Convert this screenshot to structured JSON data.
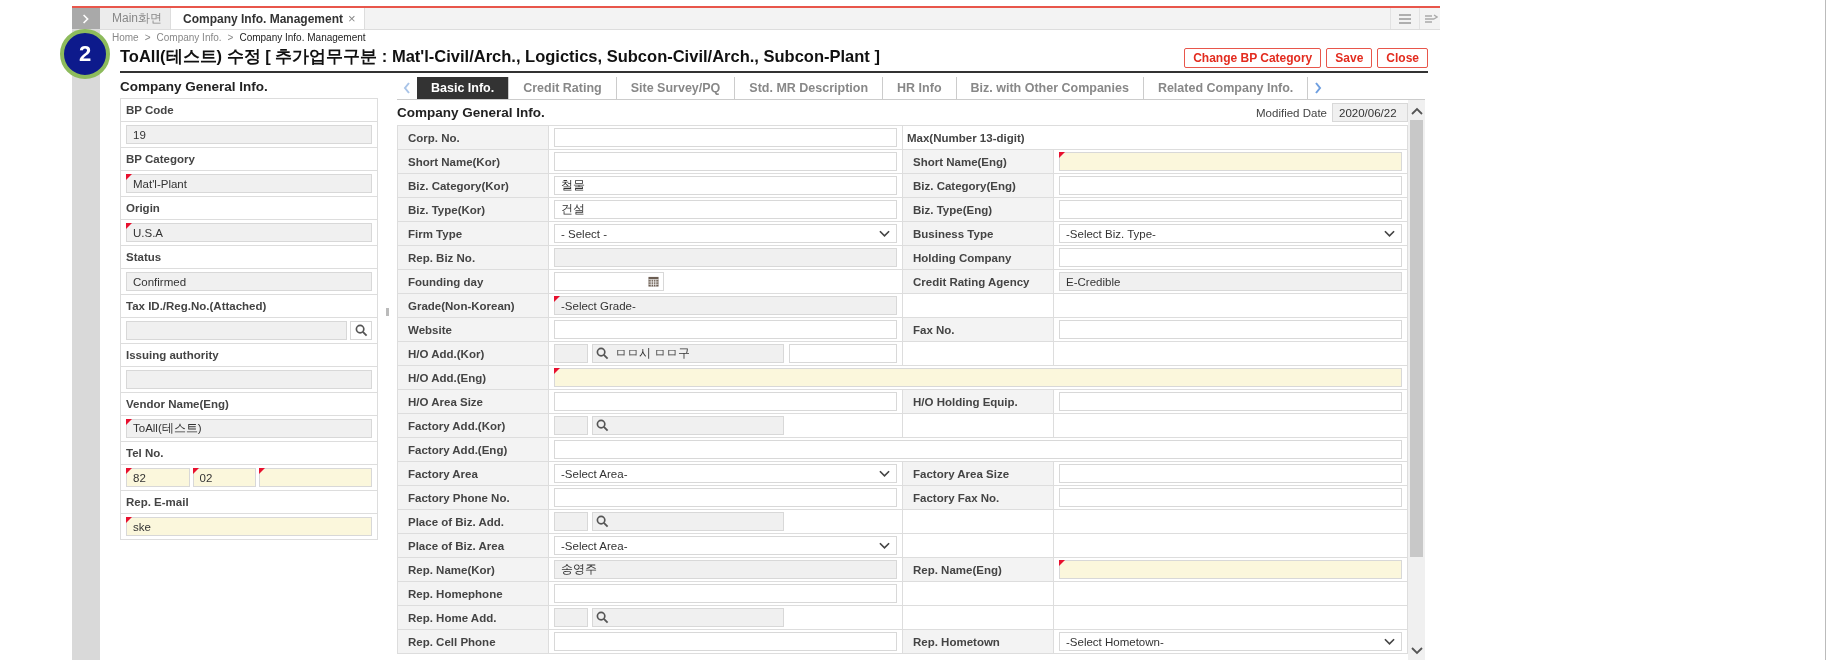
{
  "window_tabs": [
    {
      "label": "Main화면",
      "selected": false
    },
    {
      "label": "Company Info. Management",
      "selected": true,
      "close": "×"
    }
  ],
  "breadcrumb": {
    "separator": ">",
    "items": [
      "Home",
      "Company Info.",
      "Company Info. Management"
    ]
  },
  "step_badge": "2",
  "title": "ToAll(테스트) 수정 [ 추가업무구분 : Mat'l-Civil/Arch., Logictics, Subcon-Civil/Arch., Subcon-Plant ]",
  "buttons": [
    "Change BP Category",
    "Save",
    "Close"
  ],
  "left_panel": {
    "heading": "Company General Info.",
    "fields": [
      {
        "label": "BP Code",
        "parts": [
          {
            "value": "19",
            "kind": "readonly",
            "required": false
          }
        ],
        "search": false
      },
      {
        "label": "BP Category",
        "parts": [
          {
            "value": "Mat'l-Plant",
            "kind": "readonly",
            "required": true
          }
        ],
        "search": false
      },
      {
        "label": "Origin",
        "parts": [
          {
            "value": "U.S.A",
            "kind": "readonly",
            "required": true
          }
        ],
        "search": false
      },
      {
        "label": "Status",
        "parts": [
          {
            "value": "Confirmed",
            "kind": "readonly",
            "required": false
          }
        ],
        "search": false
      },
      {
        "label": "Tax ID./Reg.No.(Attached)",
        "parts": [
          {
            "kind": "readonly",
            "required": false
          }
        ],
        "search": true
      },
      {
        "label": "Issuing authority",
        "parts": [
          {
            "kind": "readonly",
            "required": false
          }
        ],
        "search": false
      },
      {
        "label": "Vendor Name(Eng)",
        "parts": [
          {
            "value": "ToAll(테스트)",
            "kind": "readonly",
            "required": true
          }
        ],
        "search": false
      },
      {
        "label": "Tel No.",
        "parts": [
          {
            "value": "82",
            "kind": "input",
            "required": true
          },
          {
            "value": "02",
            "kind": "input",
            "required": true
          },
          {
            "kind": "input",
            "required": true
          }
        ],
        "search": false
      },
      {
        "label": "Rep. E-mail",
        "parts": [
          {
            "value": "ske",
            "kind": "input",
            "required": true
          }
        ],
        "search": false
      }
    ]
  },
  "form_tabs": [
    {
      "label": "Basic Info.",
      "selected": true
    },
    {
      "label": "Credit Rating",
      "selected": false
    },
    {
      "label": "Site Survey/PQ",
      "selected": false
    },
    {
      "label": "Std. MR Description",
      "selected": false
    },
    {
      "label": "HR Info",
      "selected": false
    },
    {
      "label": "Biz. with Other Companies",
      "selected": false
    },
    {
      "label": "Related Company Info.",
      "selected": false
    }
  ],
  "form": {
    "heading": "Company General Info.",
    "modified_label": "Modified Date",
    "modified_value": "2020/06/22",
    "rows": [
      {
        "cells": [
          {
            "kind": "label",
            "text": "Corp. No."
          },
          {
            "kind": "input",
            "required": false
          },
          {
            "kind": "note",
            "text": "Max(Number 13-digit)"
          }
        ]
      },
      {
        "cells": [
          {
            "kind": "label",
            "text": "Short Name(Kor)"
          },
          {
            "kind": "input",
            "required": false
          },
          {
            "kind": "label",
            "text": "Short Name(Eng)"
          },
          {
            "kind": "input",
            "required": true
          }
        ]
      },
      {
        "cells": [
          {
            "kind": "label",
            "text": "Biz. Category(Kor)"
          },
          {
            "kind": "input",
            "value": "철물",
            "required": false
          },
          {
            "kind": "label",
            "text": "Biz. Category(Eng)"
          },
          {
            "kind": "input",
            "required": false
          }
        ]
      },
      {
        "cells": [
          {
            "kind": "label",
            "text": "Biz. Type(Kor)"
          },
          {
            "kind": "input",
            "value": "건설",
            "required": false
          },
          {
            "kind": "label",
            "text": "Biz. Type(Eng)"
          },
          {
            "kind": "input",
            "required": false
          }
        ]
      },
      {
        "cells": [
          {
            "kind": "label",
            "text": "Firm Type"
          },
          {
            "kind": "select",
            "value": "- Select -"
          },
          {
            "kind": "label",
            "text": "Business Type"
          },
          {
            "kind": "select",
            "value": "-Select Biz. Type-"
          }
        ]
      },
      {
        "cells": [
          {
            "kind": "label",
            "text": "Rep. Biz No."
          },
          {
            "kind": "readonly",
            "required": false
          },
          {
            "kind": "label",
            "text": "Holding Company"
          },
          {
            "kind": "input",
            "required": false
          }
        ]
      },
      {
        "cells": [
          {
            "kind": "label",
            "text": "Founding day"
          },
          {
            "kind": "date"
          },
          {
            "kind": "label",
            "text": "Credit Rating Agency"
          },
          {
            "kind": "readonly",
            "value": "E-Credible",
            "required": false
          }
        ]
      },
      {
        "cells": [
          {
            "kind": "label",
            "text": "Grade(Non-Korean)"
          },
          {
            "kind": "readonly",
            "value": "-Select Grade-",
            "required": true
          }
        ]
      },
      {
        "cells": [
          {
            "kind": "label",
            "text": "Website"
          },
          {
            "kind": "input",
            "required": false
          },
          {
            "kind": "label",
            "text": "Fax No."
          },
          {
            "kind": "input",
            "required": false
          }
        ]
      },
      {
        "cells": [
          {
            "kind": "label",
            "text": "H/O Add.(Kor)"
          },
          {
            "kind": "address",
            "value": "ㅁㅁ시 ㅁㅁ구",
            "detail_field": true
          }
        ]
      },
      {
        "cells": [
          {
            "kind": "label",
            "text": "H/O Add.(Eng)"
          },
          {
            "kind": "wide_input",
            "required": true
          }
        ]
      },
      {
        "cells": [
          {
            "kind": "label",
            "text": "H/O Area Size"
          },
          {
            "kind": "input",
            "required": false
          },
          {
            "kind": "label",
            "text": "H/O Holding Equip."
          },
          {
            "kind": "input",
            "required": false
          }
        ]
      },
      {
        "cells": [
          {
            "kind": "label",
            "text": "Factory Add.(Kor)"
          },
          {
            "kind": "address",
            "detail_field": false
          }
        ]
      },
      {
        "cells": [
          {
            "kind": "label",
            "text": "Factory Add.(Eng)"
          },
          {
            "kind": "wide_input",
            "required": false
          }
        ]
      },
      {
        "cells": [
          {
            "kind": "label",
            "text": "Factory Area"
          },
          {
            "kind": "select",
            "value": "-Select Area-"
          },
          {
            "kind": "label",
            "text": "Factory Area Size"
          },
          {
            "kind": "input",
            "required": false
          }
        ]
      },
      {
        "cells": [
          {
            "kind": "label",
            "text": "Factory Phone No."
          },
          {
            "kind": "input",
            "required": false
          },
          {
            "kind": "label",
            "text": "Factory Fax No."
          },
          {
            "kind": "input",
            "required": false
          }
        ]
      },
      {
        "cells": [
          {
            "kind": "label",
            "text": "Place of Biz. Add."
          },
          {
            "kind": "address",
            "detail_field": false
          }
        ]
      },
      {
        "cells": [
          {
            "kind": "label",
            "text": "Place of Biz. Area"
          },
          {
            "kind": "select",
            "value": "-Select Area-"
          }
        ]
      },
      {
        "cells": [
          {
            "kind": "label",
            "text": "Rep. Name(Kor)"
          },
          {
            "kind": "readonly",
            "value": "송영주",
            "required": false
          },
          {
            "kind": "label",
            "text": "Rep. Name(Eng)"
          },
          {
            "kind": "input",
            "required": true
          }
        ]
      },
      {
        "cells": [
          {
            "kind": "label",
            "text": "Rep. Homephone"
          },
          {
            "kind": "input",
            "required": false
          }
        ]
      },
      {
        "cells": [
          {
            "kind": "label",
            "text": "Rep. Home Add."
          },
          {
            "kind": "address",
            "detail_field": false
          }
        ]
      },
      {
        "cells": [
          {
            "kind": "label",
            "text": "Rep. Cell Phone"
          },
          {
            "kind": "input",
            "required": false
          },
          {
            "kind": "label",
            "text": "Rep. Hometown"
          },
          {
            "kind": "select",
            "value": "-Select Hometown-"
          }
        ]
      }
    ]
  }
}
